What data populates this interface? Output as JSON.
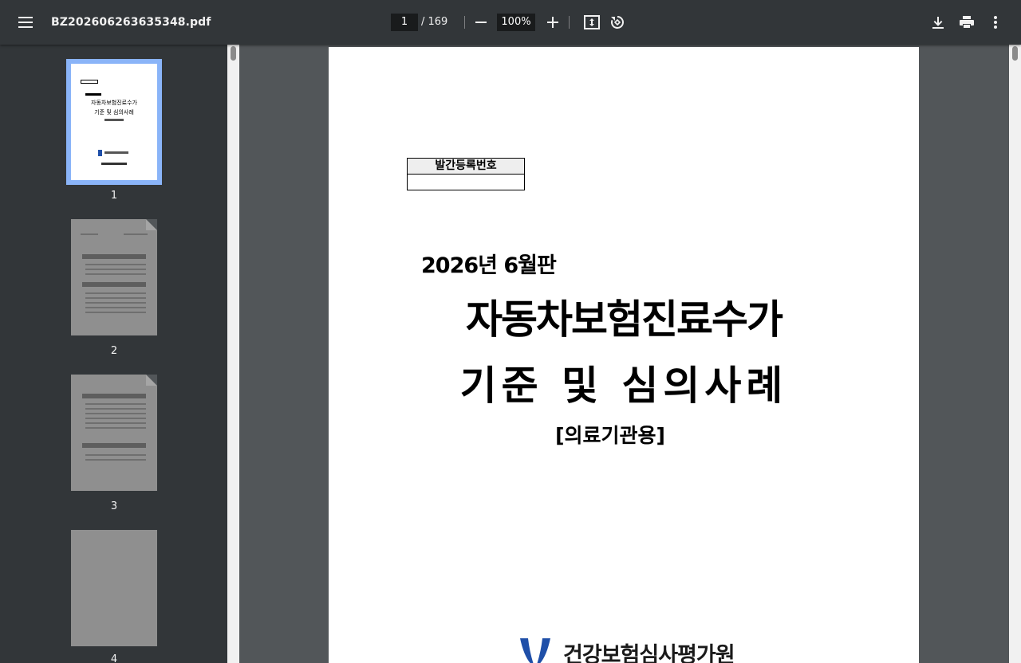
{
  "toolbar": {
    "menu_icon": "hamburger-menu-icon",
    "filename": "BZ202606263635348.pdf",
    "current_page": "1",
    "page_total": "/ 169",
    "zoom": "100%",
    "zoom_out_icon": "minus-icon",
    "zoom_in_icon": "plus-icon",
    "fit_icon": "fit-to-page-icon",
    "rotate_icon": "rotate-counterclockwise-icon",
    "download_icon": "download-icon",
    "print_icon": "print-icon",
    "more_icon": "more-vertical-icon"
  },
  "sidebar": {
    "thumbnails": [
      {
        "number": "1",
        "active": true
      },
      {
        "number": "2",
        "active": false
      },
      {
        "number": "3",
        "active": false
      },
      {
        "number": "4",
        "active": false
      }
    ],
    "thumb1_title_line1": "자동차보험진료수가",
    "thumb1_title_line2": "기준 및 심의사례"
  },
  "document": {
    "registration_label": "발간등록번호",
    "registration_value": "",
    "edition": "2026년 6월판",
    "title_line1": "자동차보험진료수가",
    "title_line2": "기준 및 심의사례",
    "subtitle": "[의료기관용]",
    "organization": "건강보험심사평가원"
  },
  "colors": {
    "toolbar_bg": "#323639",
    "viewer_bg": "#525659",
    "active_thumb_outline": "#8ab4f8",
    "logo_blue": "#1f4fa8"
  }
}
